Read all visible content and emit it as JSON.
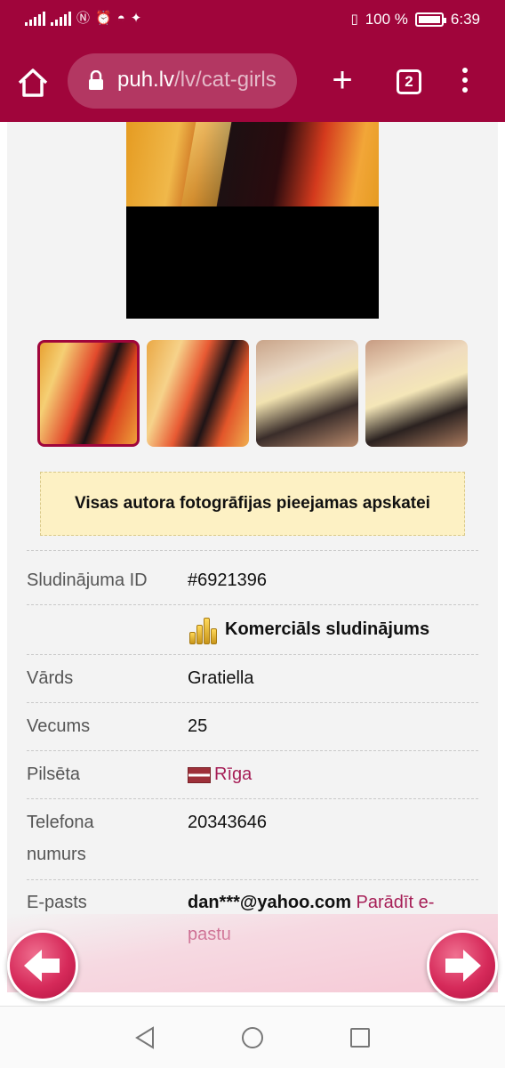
{
  "status_bar": {
    "battery_percent": "100 %",
    "time": "6:39"
  },
  "browser": {
    "url_host": "puh.lv",
    "url_path": "/lv/cat-girls",
    "tab_count": "2"
  },
  "notice": "Visas autora fotogrāfijas pieejamas apskatei",
  "details": {
    "ad_id_label": "Sludinājuma ID",
    "ad_id_value": "#6921396",
    "commercial_label": "Komerciāls sludinājums",
    "name_label": "Vārds",
    "name_value": "Gratiella",
    "age_label": "Vecums",
    "age_value": "25",
    "city_label": "Pilsēta",
    "city_value": "Rīga",
    "phone_label_1": "Telefona",
    "phone_label_2": "numurs",
    "phone_value": "20343646",
    "email_label": "E-pasts",
    "email_value": "dan***@yahoo.com",
    "show_email_1": "Parādīt e-",
    "show_email_2": "pastu"
  },
  "thumbnails": [
    "photo-1",
    "photo-2",
    "photo-3",
    "photo-4"
  ],
  "colors": {
    "brand": "#a0053b",
    "link": "#a61e56",
    "notice_bg": "#fdf1c4"
  }
}
